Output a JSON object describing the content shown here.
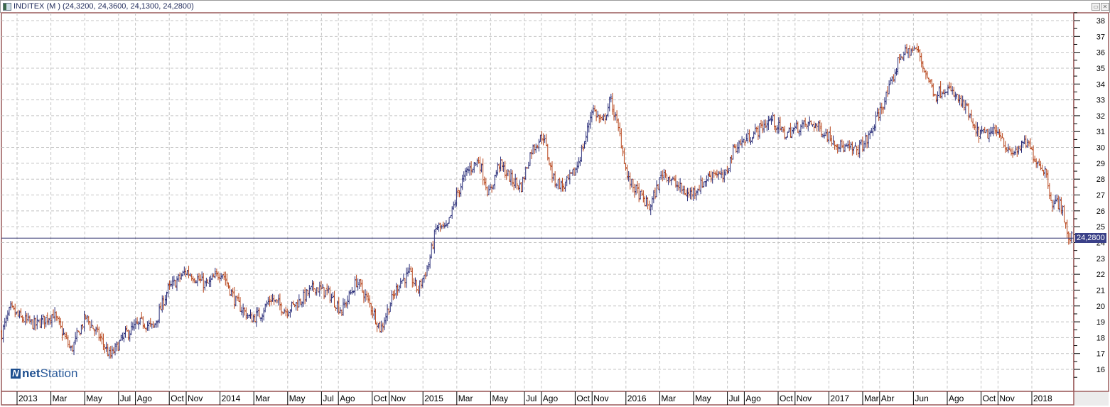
{
  "window": {
    "title": "INDITEX (M ) (24,3200, 24,3600, 24,1300, 24,2800)",
    "restore_label": "▭",
    "close_label": "✕"
  },
  "logo": {
    "mark": "N",
    "brand_bold": "net",
    "brand_rest": "Station"
  },
  "colors": {
    "up": "#2b2f7a",
    "down": "#b8461c",
    "frame": "#9a5a5a",
    "grid": "#c4c4c4",
    "price_line": "#2b2f6a"
  },
  "chart_data": {
    "type": "ohlc",
    "title": "INDITEX (M )",
    "last": {
      "open": "24,3200",
      "high": "24,3600",
      "low": "24,1300",
      "close": "24,2800",
      "value": 24.28,
      "label": "24,2800"
    },
    "ylim": [
      15,
      38.5
    ],
    "yticks": [
      16,
      17,
      18,
      19,
      20,
      21,
      22,
      23,
      24,
      25,
      26,
      27,
      28,
      29,
      30,
      31,
      32,
      33,
      34,
      35,
      36,
      37,
      38
    ],
    "x_unit": "months since Jan 2013",
    "xlim": [
      -0.93,
      62.7
    ],
    "x_labels": [
      {
        "label": "2013",
        "month": 0
      },
      {
        "label": "Mar",
        "month": 2
      },
      {
        "label": "May",
        "month": 4
      },
      {
        "label": "Jul",
        "month": 6
      },
      {
        "label": "Ago",
        "month": 7
      },
      {
        "label": "Oct",
        "month": 9
      },
      {
        "label": "Nov",
        "month": 10
      },
      {
        "label": "2014",
        "month": 12
      },
      {
        "label": "Mar",
        "month": 14
      },
      {
        "label": "May",
        "month": 16
      },
      {
        "label": "Jul",
        "month": 18
      },
      {
        "label": "Ago",
        "month": 19
      },
      {
        "label": "Oct",
        "month": 21
      },
      {
        "label": "Nov",
        "month": 22
      },
      {
        "label": "2015",
        "month": 24
      },
      {
        "label": "Mar",
        "month": 26
      },
      {
        "label": "May",
        "month": 28
      },
      {
        "label": "Jul",
        "month": 30
      },
      {
        "label": "Ago",
        "month": 31
      },
      {
        "label": "Oct",
        "month": 33
      },
      {
        "label": "Nov",
        "month": 34
      },
      {
        "label": "2016",
        "month": 36
      },
      {
        "label": "Mar",
        "month": 38
      },
      {
        "label": "May",
        "month": 40
      },
      {
        "label": "Jul",
        "month": 42
      },
      {
        "label": "Ago",
        "month": 43
      },
      {
        "label": "Oct",
        "month": 45
      },
      {
        "label": "Nov",
        "month": 46
      },
      {
        "label": "2017",
        "month": 48
      },
      {
        "label": "Mar",
        "month": 50
      },
      {
        "label": "Abr",
        "month": 51
      },
      {
        "label": "Jun",
        "month": 53
      },
      {
        "label": "Ago",
        "month": 55
      },
      {
        "label": "Oct",
        "month": 57
      },
      {
        "label": "Nov",
        "month": 58
      },
      {
        "label": "2018",
        "month": 60
      }
    ],
    "price_path": [
      [
        -0.9,
        18.3
      ],
      [
        -0.4,
        19.8
      ],
      [
        0.25,
        19.2
      ],
      [
        1.1,
        18.8
      ],
      [
        2.15,
        19.5
      ],
      [
        3.2,
        17.2
      ],
      [
        4.05,
        19.3
      ],
      [
        4.9,
        18
      ],
      [
        5.5,
        16.8
      ],
      [
        6.4,
        18.2
      ],
      [
        7.4,
        19
      ],
      [
        8.05,
        18.6
      ],
      [
        8.9,
        21
      ],
      [
        10,
        22.2
      ],
      [
        11.2,
        21.3
      ],
      [
        12.1,
        22.2
      ],
      [
        12.9,
        20.3
      ],
      [
        13.8,
        19.2
      ],
      [
        14.4,
        19.5
      ],
      [
        15,
        20.5
      ],
      [
        15.9,
        19.7
      ],
      [
        16.7,
        20.3
      ],
      [
        17.6,
        21.2
      ],
      [
        18.4,
        20.8
      ],
      [
        19.2,
        19.7
      ],
      [
        20.1,
        21.6
      ],
      [
        20.9,
        20
      ],
      [
        21.5,
        18.5
      ],
      [
        22,
        20
      ],
      [
        22.6,
        21.5
      ],
      [
        23.2,
        22
      ],
      [
        23.7,
        21
      ],
      [
        24.3,
        22.5
      ],
      [
        24.8,
        25
      ],
      [
        25.4,
        24.8
      ],
      [
        26,
        27
      ],
      [
        26.6,
        28.5
      ],
      [
        27.3,
        29.2
      ],
      [
        27.9,
        27
      ],
      [
        28.5,
        29
      ],
      [
        29.2,
        28
      ],
      [
        29.8,
        27.5
      ],
      [
        30.4,
        29.8
      ],
      [
        31.1,
        30.8
      ],
      [
        31.7,
        28
      ],
      [
        32.3,
        27.5
      ],
      [
        33,
        28.5
      ],
      [
        33.6,
        30.5
      ],
      [
        34,
        32.5
      ],
      [
        34.6,
        31.5
      ],
      [
        35.1,
        33
      ],
      [
        35.7,
        30.5
      ],
      [
        36.1,
        28
      ],
      [
        36.8,
        27
      ],
      [
        37.4,
        26.2
      ],
      [
        38.2,
        28.5
      ],
      [
        39.1,
        27.5
      ],
      [
        39.7,
        27
      ],
      [
        40.3,
        27.5
      ],
      [
        41.2,
        28.5
      ],
      [
        41.8,
        28
      ],
      [
        42.4,
        30
      ],
      [
        43.1,
        30.5
      ],
      [
        43.7,
        31
      ],
      [
        44.6,
        31.8
      ],
      [
        45.4,
        30.8
      ],
      [
        46.2,
        31.3
      ],
      [
        47.1,
        31.5
      ],
      [
        47.9,
        30.8
      ],
      [
        48.8,
        30
      ],
      [
        49.6,
        29.8
      ],
      [
        50.3,
        30.5
      ],
      [
        50.9,
        32
      ],
      [
        51.7,
        34
      ],
      [
        52.2,
        35.8
      ],
      [
        52.8,
        36.1
      ],
      [
        53.2,
        36.2
      ],
      [
        53.8,
        34.5
      ],
      [
        54.3,
        33.3
      ],
      [
        54.9,
        33.8
      ],
      [
        55.5,
        33.2
      ],
      [
        56.2,
        32.3
      ],
      [
        56.6,
        31
      ],
      [
        57.2,
        30.8
      ],
      [
        58.1,
        31
      ],
      [
        58.7,
        29.5
      ],
      [
        59.3,
        30
      ],
      [
        59.7,
        30.3
      ],
      [
        60.2,
        29.3
      ],
      [
        60.8,
        28.5
      ],
      [
        61.2,
        26.5
      ],
      [
        61.5,
        26.5
      ],
      [
        61.8,
        26.3
      ],
      [
        62.1,
        24.3
      ],
      [
        62.4,
        24.28
      ]
    ]
  }
}
